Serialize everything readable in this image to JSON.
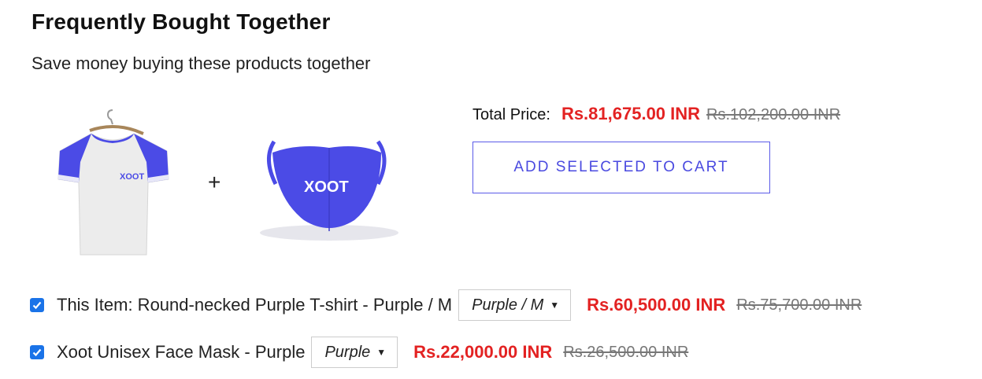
{
  "header": {
    "title": "Frequently Bought Together",
    "subtitle": "Save money buying these products together"
  },
  "products_preview": {
    "tshirt_brand": "XOOT",
    "mask_brand": "XOOT",
    "plus": "+"
  },
  "total": {
    "label": "Total Price:",
    "price": "Rs.81,675.00 INR",
    "compare_price": "Rs.102,200.00 INR"
  },
  "cart_button": {
    "label": "ADD SELECTED TO CART"
  },
  "items": [
    {
      "checked": true,
      "name": "This Item: Round-necked Purple T-shirt - Purple / M",
      "variant": "Purple / M",
      "price": "Rs.60,500.00 INR",
      "compare_price": "Rs.75,700.00 INR"
    },
    {
      "checked": true,
      "name": "Xoot Unisex Face Mask - Purple",
      "variant": "Purple",
      "price": "Rs.22,000.00 INR",
      "compare_price": "Rs.26,500.00 INR"
    }
  ],
  "colors": {
    "accent": "#4a4ae0",
    "price_red": "#e32222",
    "product_purple": "#4b4be6",
    "checkbox_blue": "#1a73e8"
  }
}
